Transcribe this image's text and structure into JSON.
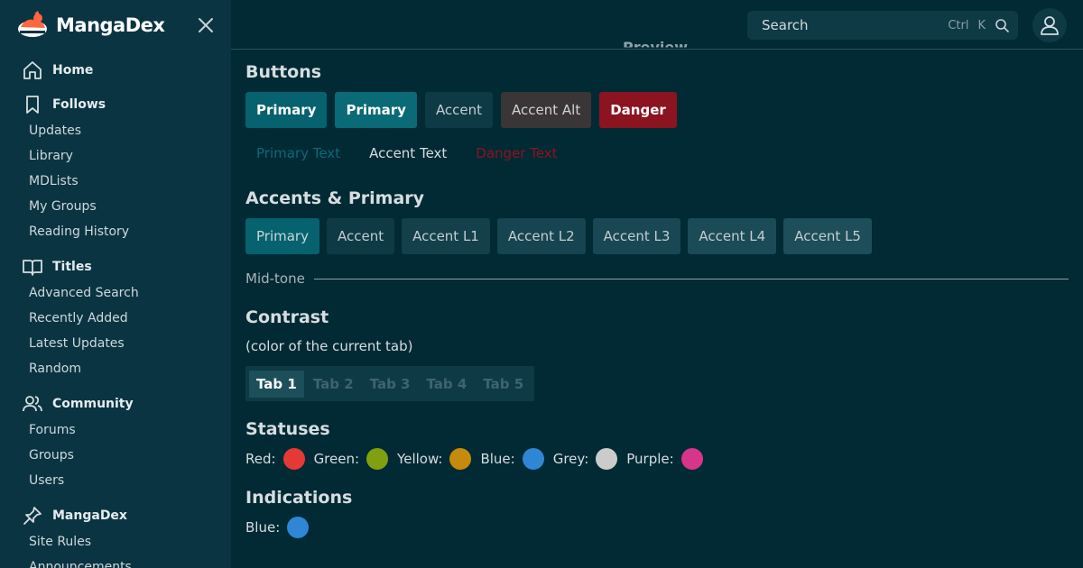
{
  "brand": {
    "name": "MangaDex"
  },
  "sidebar": {
    "sections": [
      {
        "label": "Home",
        "icon": "home-icon",
        "items": []
      },
      {
        "label": "Follows",
        "icon": "bookmark-icon",
        "items": [
          "Updates",
          "Library",
          "MDLists",
          "My Groups",
          "Reading History"
        ]
      },
      {
        "label": "Titles",
        "icon": "book-icon",
        "items": [
          "Advanced Search",
          "Recently Added",
          "Latest Updates",
          "Random"
        ]
      },
      {
        "label": "Community",
        "icon": "users-icon",
        "items": [
          "Forums",
          "Groups",
          "Users"
        ]
      },
      {
        "label": "MangaDex",
        "icon": "pin-icon",
        "items": [
          "Site Rules",
          "Announcements"
        ]
      }
    ]
  },
  "topbar": {
    "search_placeholder": "Search",
    "shortcut_ctrl": "Ctrl",
    "shortcut_key": "K",
    "peek_title": "Preview"
  },
  "main": {
    "buttons_heading": "Buttons",
    "buttons": [
      "Primary",
      "Primary",
      "Accent",
      "Accent Alt",
      "Danger"
    ],
    "text_buttons": [
      "Primary Text",
      "Accent Text",
      "Danger Text"
    ],
    "accents_heading": "Accents & Primary",
    "accents": [
      "Primary",
      "Accent",
      "Accent L1",
      "Accent L2",
      "Accent L3",
      "Accent L4",
      "Accent L5"
    ],
    "midtone_label": "Mid-tone",
    "contrast_heading": "Contrast",
    "contrast_note": "(color of the current tab)",
    "tabs": [
      "Tab 1",
      "Tab 2",
      "Tab 3",
      "Tab 4",
      "Tab 5"
    ],
    "active_tab": "Tab 1",
    "statuses_heading": "Statuses",
    "statuses": [
      {
        "label": "Red:",
        "color": "#e53935"
      },
      {
        "label": "Green:",
        "color": "#80a010"
      },
      {
        "label": "Yellow:",
        "color": "#c68a0c"
      },
      {
        "label": "Blue:",
        "color": "#2e86d4"
      },
      {
        "label": "Grey:",
        "color": "#cbcbcb"
      },
      {
        "label": "Purple:",
        "color": "#d6358a"
      }
    ],
    "indications_heading": "Indications",
    "indications": [
      {
        "label": "Blue:",
        "color": "#2e86d4"
      }
    ]
  },
  "colors": {
    "brand_accent": "#ff6740",
    "primary": "#05626e",
    "danger": "#8c1320"
  }
}
